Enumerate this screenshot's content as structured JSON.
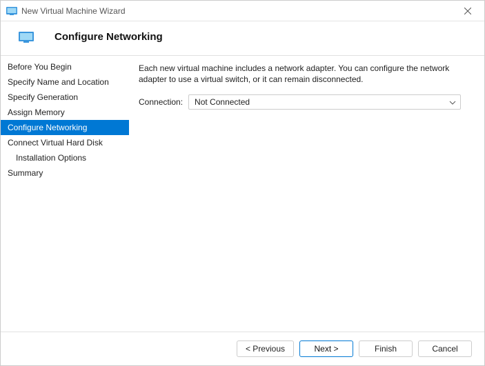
{
  "window": {
    "title": "New Virtual Machine Wizard"
  },
  "header": {
    "title": "Configure Networking"
  },
  "sidebar": {
    "items": [
      {
        "label": "Before You Begin",
        "selected": false,
        "indent": false
      },
      {
        "label": "Specify Name and Location",
        "selected": false,
        "indent": false
      },
      {
        "label": "Specify Generation",
        "selected": false,
        "indent": false
      },
      {
        "label": "Assign Memory",
        "selected": false,
        "indent": false
      },
      {
        "label": "Configure Networking",
        "selected": true,
        "indent": false
      },
      {
        "label": "Connect Virtual Hard Disk",
        "selected": false,
        "indent": false
      },
      {
        "label": "Installation Options",
        "selected": false,
        "indent": true
      },
      {
        "label": "Summary",
        "selected": false,
        "indent": false
      }
    ]
  },
  "content": {
    "description": "Each new virtual machine includes a network adapter. You can configure the network adapter to use a virtual switch, or it can remain disconnected.",
    "connection_label": "Connection:",
    "connection_value": "Not Connected"
  },
  "footer": {
    "previous": "< Previous",
    "next": "Next >",
    "finish": "Finish",
    "cancel": "Cancel"
  }
}
